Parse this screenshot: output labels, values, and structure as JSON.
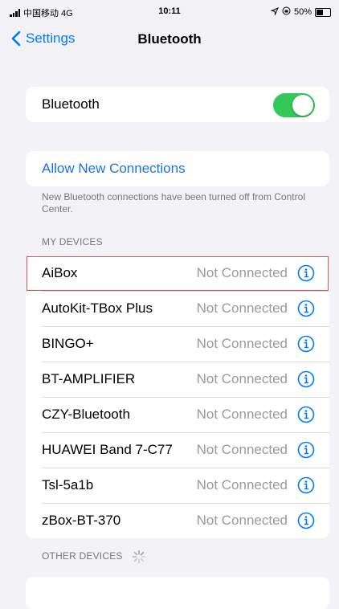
{
  "status_bar": {
    "carrier": "中国移动 4G",
    "time": "10:11",
    "battery_text": "50%",
    "battery_level": 0.5
  },
  "nav": {
    "back_label": "Settings",
    "title": "Bluetooth"
  },
  "bluetooth_toggle": {
    "label": "Bluetooth",
    "on": true
  },
  "allow_new": {
    "label": "Allow New Connections",
    "footnote": "New Bluetooth connections have been turned off from Control Center."
  },
  "my_devices": {
    "header": "MY DEVICES",
    "items": [
      {
        "name": "AiBox",
        "status": "Not Connected"
      },
      {
        "name": "AutoKit-TBox Plus",
        "status": "Not Connected"
      },
      {
        "name": "BINGO+",
        "status": "Not Connected"
      },
      {
        "name": "BT-AMPLIFIER",
        "status": "Not Connected"
      },
      {
        "name": "CZY-Bluetooth",
        "status": "Not Connected"
      },
      {
        "name": "HUAWEI Band 7-C77",
        "status": "Not Connected"
      },
      {
        "name": "Tsl-5a1b",
        "status": "Not Connected"
      },
      {
        "name": "zBox-BT-370",
        "status": "Not Connected"
      }
    ]
  },
  "other_devices": {
    "header": "OTHER DEVICES"
  },
  "colors": {
    "accent": "#007aff",
    "toggle_on": "#34c759",
    "highlight": "#d9534f",
    "background": "#f2f2f7"
  },
  "icons": {
    "back": "chevron-left-icon",
    "info": "info-icon",
    "spinner": "activity-spinner-icon"
  }
}
